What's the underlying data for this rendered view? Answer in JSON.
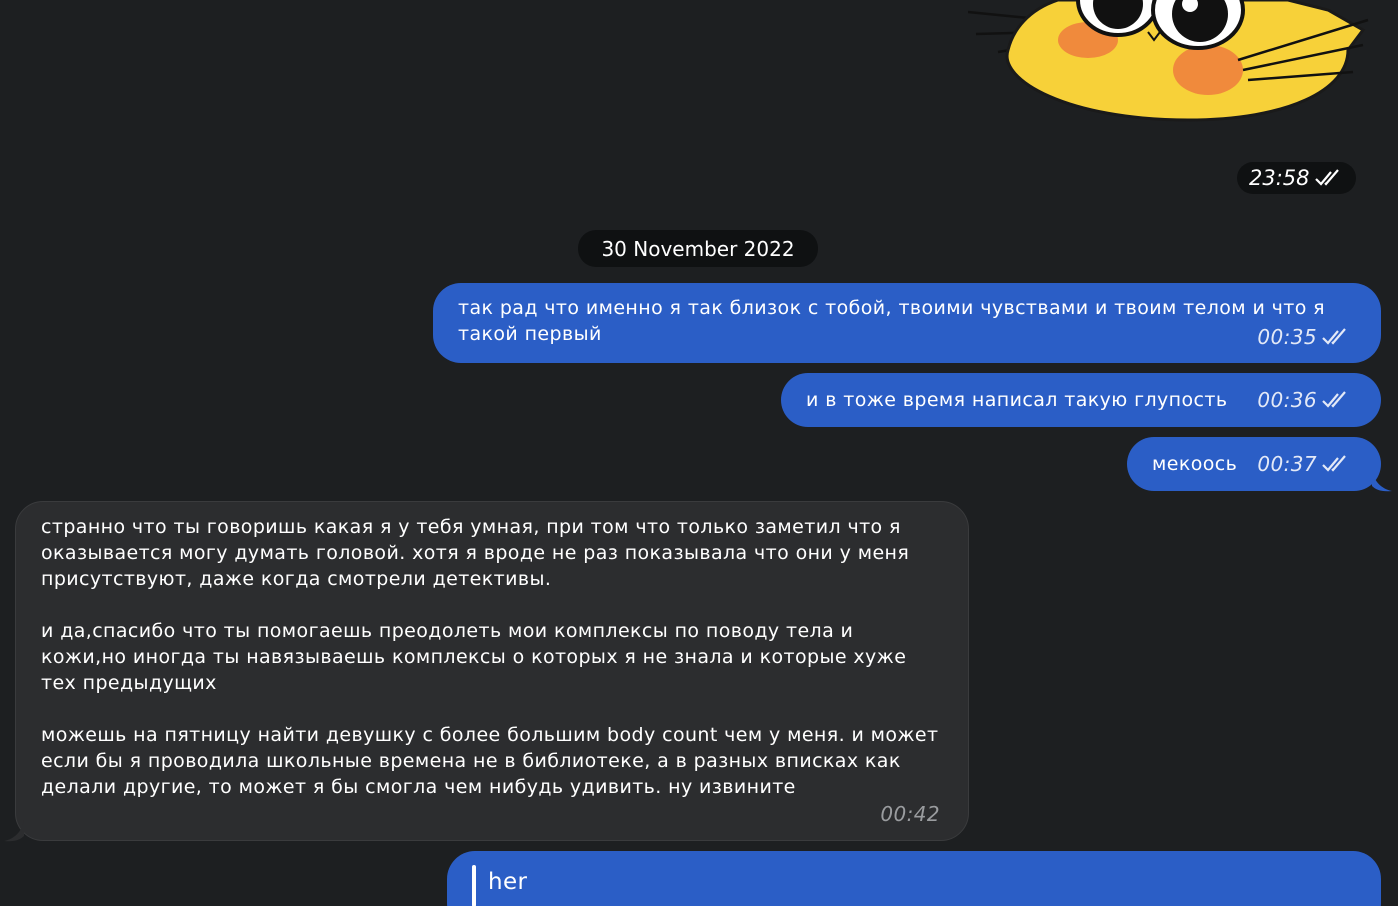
{
  "sticker": {
    "time": "23:58",
    "status_icon": "double-check-icon"
  },
  "date_separator": "30 November 2022",
  "messages": [
    {
      "direction": "out",
      "text": "так рад что именно я так близок с тобой, твоими чувствами и твоим телом и что я такой первый",
      "time": "00:35",
      "status_icon": "double-check-icon"
    },
    {
      "direction": "out",
      "text": "и в тоже время написал такую глупость",
      "time": "00:36",
      "status_icon": "double-check-icon"
    },
    {
      "direction": "out",
      "text": "мекоось",
      "time": "00:37",
      "status_icon": "double-check-icon"
    },
    {
      "direction": "in",
      "paragraphs": [
        "странно что ты говоришь какая я у тебя умная, при том что только заметил что я оказывается могу думать головой. хотя я вроде не раз показывала что они у меня присутствуют, даже когда смотрели детективы.",
        "и да,спасибо что ты помогаешь преодолеть мои комплексы по поводу тела и кожи,но иногда ты навязываешь комплексы о которых я не знала и которые хуже тех предыдущих",
        "можешь на пятницу найти девушку с более большим body count чем у меня. и может если бы я проводила школьные времена не в библиотеке, а в разных вписках как делали другие, то может я бы смогла чем нибудь удивить. ну извините"
      ],
      "time": "00:42"
    },
    {
      "direction": "out",
      "reply_to": "her"
    }
  ],
  "colors": {
    "background": "#1d1f21",
    "outgoing_bubble": "#2b5ec6",
    "incoming_bubble": "#2c2d2f",
    "pill": "#0f1112"
  }
}
